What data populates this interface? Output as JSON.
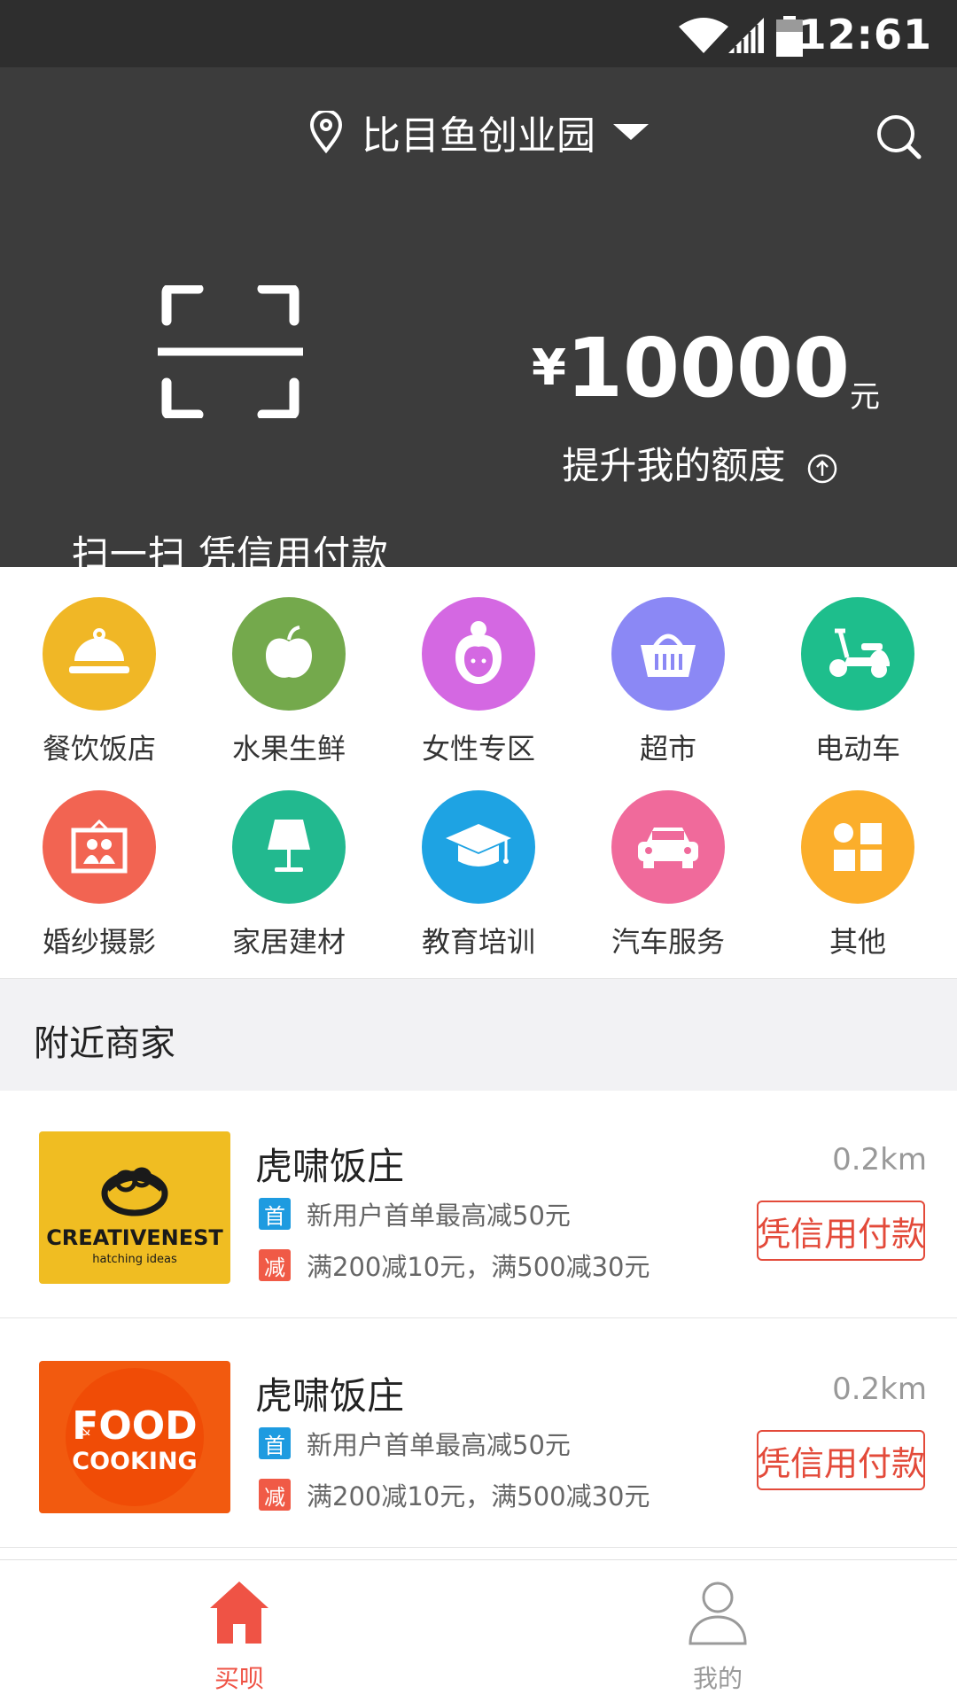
{
  "status_bar": {
    "time": "12:61"
  },
  "header": {
    "location": "比目鱼创业园"
  },
  "hero": {
    "scan_label": "扫一扫  凭信用付款",
    "credit_currency": "¥",
    "credit_amount": "10000",
    "credit_unit": "元",
    "raise_label": "提升我的额度"
  },
  "categories": [
    {
      "label": "餐饮饭店",
      "icon": "cloche-icon",
      "color": "#f0b726"
    },
    {
      "label": "水果生鲜",
      "icon": "apple-icon",
      "color": "#74a94c"
    },
    {
      "label": "女性专区",
      "icon": "woman-icon",
      "color": "#d468e2"
    },
    {
      "label": "超市",
      "icon": "basket-icon",
      "color": "#8b88f5"
    },
    {
      "label": "电动车",
      "icon": "scooter-icon",
      "color": "#1ebe8c"
    },
    {
      "label": "婚纱摄影",
      "icon": "photo-frame-icon",
      "color": "#f26452"
    },
    {
      "label": "家居建材",
      "icon": "lamp-icon",
      "color": "#22b98f"
    },
    {
      "label": "教育培训",
      "icon": "graduation-cap-icon",
      "color": "#1ea3e3"
    },
    {
      "label": "汽车服务",
      "icon": "car-icon",
      "color": "#f06a9b"
    },
    {
      "label": "其他",
      "icon": "grid-icon",
      "color": "#fbae2b"
    }
  ],
  "nearby": {
    "title": "附近商家",
    "merchants": [
      {
        "name": "虎啸饭庄",
        "distance": "0.2km",
        "logo": {
          "brand": "CREATIVENEST",
          "tagline": "hatching ideas",
          "bg": "#f0bd22"
        },
        "promo1_tag": "首",
        "promo1": "新用户首单最高减50元",
        "promo2_tag": "减",
        "promo2": "满200减10元，满500减30元",
        "pay_label": "凭信用付款"
      },
      {
        "name": "虎啸饭庄",
        "distance": "0.2km",
        "logo": {
          "brand_top": "FOOD",
          "brand_amp": "&",
          "brand_bottom": "COOKING",
          "bg": "#f25a0f"
        },
        "promo1_tag": "首",
        "promo1": "新用户首单最高减50元",
        "promo2_tag": "减",
        "promo2": "满200减10元，满500减30元",
        "pay_label": "凭信用付款"
      }
    ]
  },
  "tabs": [
    {
      "label": "买呗",
      "icon": "home-icon",
      "active": true,
      "color": "#ef5345"
    },
    {
      "label": "我的",
      "icon": "user-icon",
      "active": false,
      "color": "#9a9a9a"
    }
  ]
}
